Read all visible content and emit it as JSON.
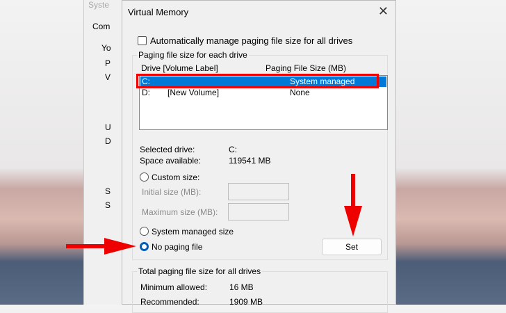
{
  "background_window": {
    "title": "Syste",
    "tab": "Com",
    "fragments": [
      "Yo",
      "P",
      "V",
      "U",
      "D",
      "S",
      "S"
    ]
  },
  "dialog": {
    "title": "Virtual Memory",
    "auto_manage_label": "Automatically manage paging file size for all drives",
    "auto_manage_checked": false,
    "drive_group_label": "Paging file size for each drive",
    "columns": [
      "Drive  [Volume Label]",
      "Paging File Size (MB)"
    ],
    "drives": [
      {
        "drive": "C:",
        "label": "",
        "size": "System managed",
        "selected": true
      },
      {
        "drive": "D:",
        "label": "[New Volume]",
        "size": "None",
        "selected": false
      }
    ],
    "selected_drive_label": "Selected drive:",
    "selected_drive_value": "C:",
    "space_label": "Space available:",
    "space_value": "119541 MB",
    "custom_size_label": "Custom size:",
    "initial_size_label": "Initial size (MB):",
    "initial_size_value": "",
    "max_size_label": "Maximum size (MB):",
    "max_size_value": "",
    "system_managed_label": "System managed size",
    "no_paging_label": "No paging file",
    "selected_option": "No paging file",
    "set_label": "Set",
    "total_group_label": "Total paging file size for all drives",
    "min_label": "Minimum allowed:",
    "min_value": "16 MB",
    "rec_label": "Recommended:",
    "rec_value": "1909 MB"
  },
  "annotation_color": "#e00000"
}
